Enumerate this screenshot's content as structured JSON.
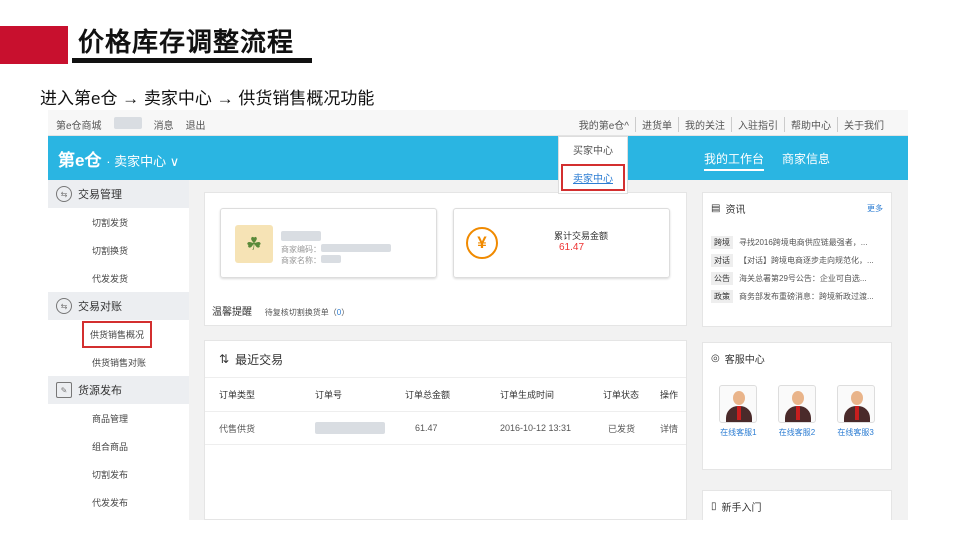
{
  "slide": {
    "title": "价格库存调整流程",
    "subtitle": "进入第e仓 → 卖家中心 → 供货销售概况功能"
  },
  "topnav": {
    "left": [
      "第e仓商城",
      "消息",
      "退出"
    ],
    "right": [
      "我的第e仓^",
      "进货单",
      "我的关注",
      "入驻指引",
      "帮助中心",
      "关于我们"
    ]
  },
  "dropdown": {
    "buyer": "买家中心",
    "seller": "卖家中心"
  },
  "header": {
    "brand": "第e仓",
    "section": "· 卖家中心 ∨",
    "nav": [
      "我的工作台",
      "商家信息"
    ]
  },
  "sidebar": {
    "groups": [
      {
        "title": "交易管理",
        "items": [
          "切割发货",
          "切割换货",
          "代发发货"
        ]
      },
      {
        "title": "交易对账",
        "items": [
          "供货销售概况",
          "供货销售对账"
        ]
      },
      {
        "title": "货源发布",
        "items": [
          "商品管理",
          "组合商品",
          "切割发布",
          "代发发布"
        ]
      }
    ]
  },
  "summary": {
    "account_label": "商家编码：",
    "name_label": "商家名称：",
    "total_label": "累计交易金额",
    "total_value": "61.47",
    "tip_title": "温馨提醒",
    "tip_text": "待复核切割换货单（",
    "tip_count": "0",
    "tip_end": "）"
  },
  "recent": {
    "title": "最近交易",
    "columns": [
      "订单类型",
      "订单号",
      "订单总金额",
      "订单生成时间",
      "订单状态",
      "操作"
    ],
    "rows": [
      {
        "type": "代售供货",
        "amount": "61.47",
        "time": "2016-10-12 13:31",
        "status": "已发货",
        "action": "详情"
      }
    ]
  },
  "news": {
    "title": "资讯",
    "more": "更多",
    "items": [
      {
        "tag": "跨境",
        "text": "寻找2016跨境电商供应链最强者，..."
      },
      {
        "tag": "对话",
        "text": "【对话】跨境电商逐步走向规范化，..."
      },
      {
        "tag": "公告",
        "text": "海关总署第29号公告：企业可自选..."
      },
      {
        "tag": "政策",
        "text": "商务部发布重磅消息：跨境新政过渡..."
      }
    ]
  },
  "service": {
    "title": "客服中心",
    "agents": [
      "在线客服1",
      "在线客服2",
      "在线客服3"
    ]
  },
  "newbie": {
    "title": "新手入门"
  }
}
